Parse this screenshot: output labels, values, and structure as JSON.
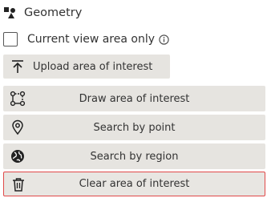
{
  "header": {
    "title": "Geometry",
    "icon": "geometry-shapes-icon"
  },
  "current_view": {
    "label": "Current view area only",
    "checked": false,
    "info_icon": "info-icon"
  },
  "buttons": {
    "upload": {
      "label": "Upload area of interest",
      "icon": "upload-icon"
    },
    "draw": {
      "label": "Draw area of interest",
      "icon": "polygon-draw-icon"
    },
    "point": {
      "label": "Search by point",
      "icon": "map-pin-icon"
    },
    "region": {
      "label": "Search by region",
      "icon": "globe-icon"
    },
    "clear": {
      "label": "Clear area of interest",
      "icon": "trash-icon"
    }
  },
  "colors": {
    "button_bg": "#e6e4e0",
    "danger_border": "#e04848",
    "text": "#333333"
  }
}
